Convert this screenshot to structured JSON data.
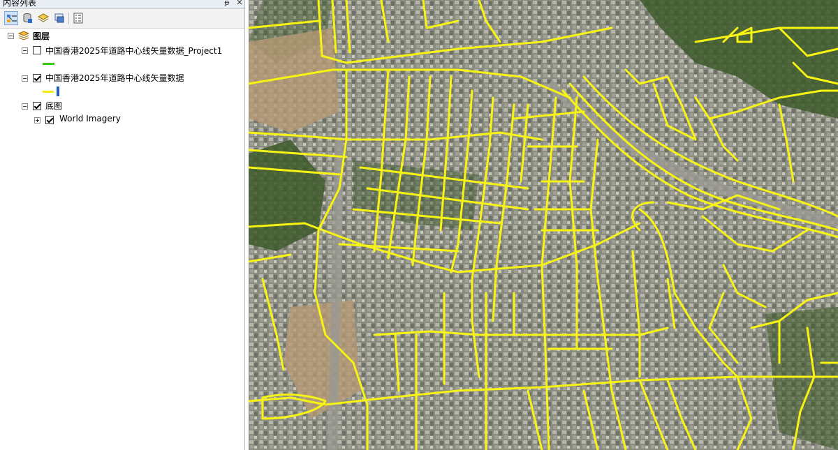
{
  "toc": {
    "title": "内容列表",
    "pin_glyph": "ᵽ",
    "close_glyph": "✕",
    "toolbar": [
      "list-by-drawing-order-icon",
      "list-by-source-icon",
      "list-by-visibility-icon",
      "list-by-selection-icon",
      "options-icon"
    ],
    "root": {
      "label": "图层",
      "expanded": true
    },
    "layers": [
      {
        "label": "中国香港2025年道路中心线矢量数据_Project1",
        "checked": false,
        "expanded": true,
        "symbol_color": "#3cc61a"
      },
      {
        "label": "中国香港2025年道路中心线矢量数据",
        "checked": true,
        "expanded": true,
        "symbol_color": "#f2ec12",
        "accent_color": "#1f5fbf"
      },
      {
        "label": "底图",
        "checked": true,
        "expanded": true,
        "children": [
          {
            "label": "World Imagery",
            "checked": true,
            "expanded": false
          }
        ]
      }
    ]
  },
  "map": {
    "road_color": "#f7f313",
    "imagery_tint": "#7d8a66"
  }
}
